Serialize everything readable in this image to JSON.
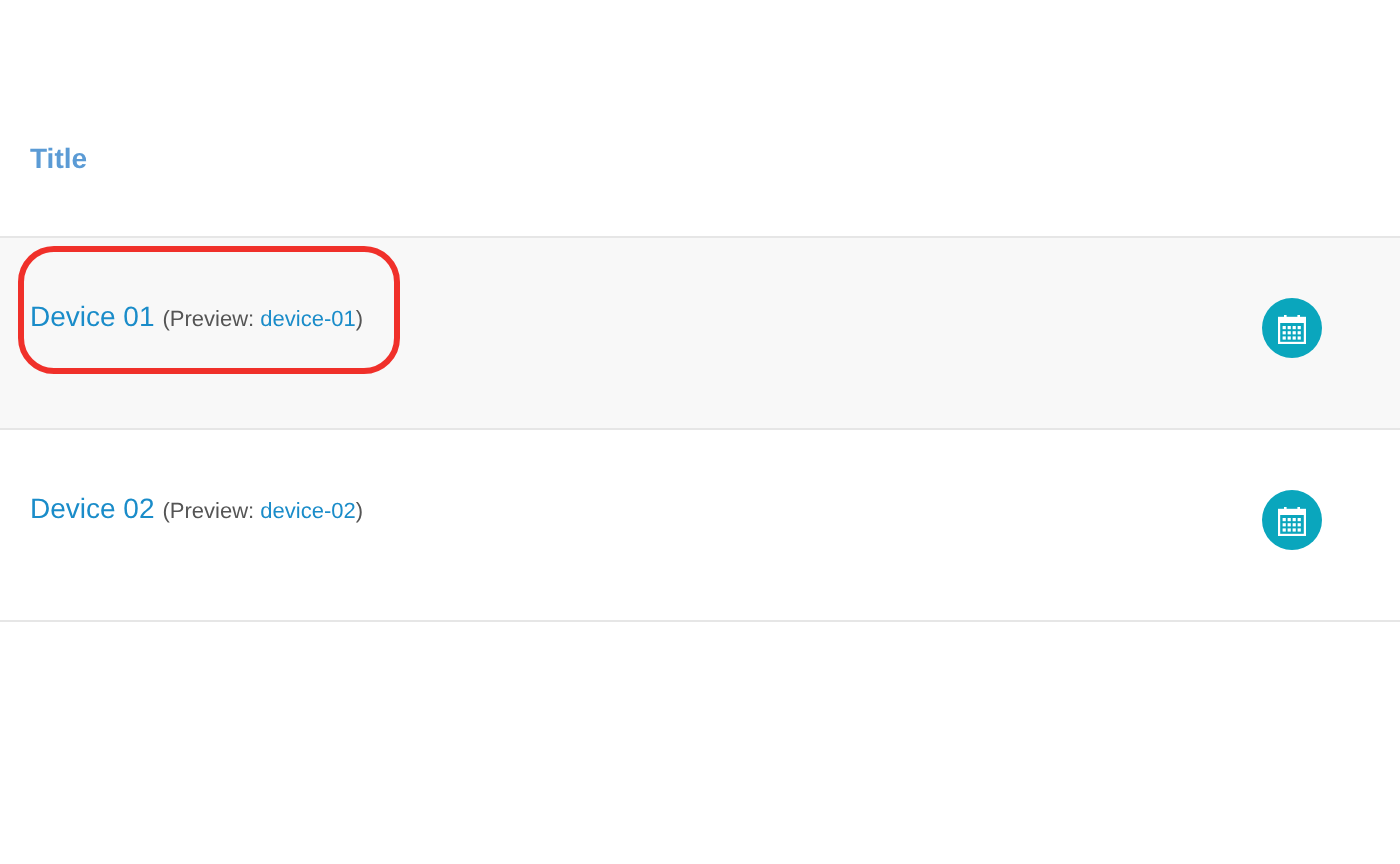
{
  "table": {
    "column_title": "Title",
    "rows": [
      {
        "name": "Device 01",
        "preview_open": "(Preview:",
        "preview_slug": "device-01",
        "preview_close": ")",
        "highlighted": true
      },
      {
        "name": "Device 02",
        "preview_open": "(Preview:",
        "preview_slug": "device-02",
        "preview_close": ")",
        "highlighted": false
      }
    ]
  }
}
